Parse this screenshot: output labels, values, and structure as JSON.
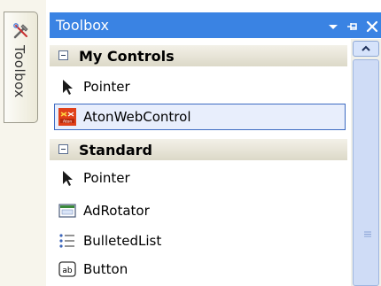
{
  "toolbox_tab": {
    "label": "Toolbox",
    "icon": "tools-icon"
  },
  "titlebar": {
    "title": "Toolbox",
    "buttons": [
      "dropdown-arrow-icon",
      "pin-icon",
      "close-icon"
    ]
  },
  "categories": [
    {
      "label": "My Controls",
      "items": [
        {
          "label": "Pointer",
          "icon": "pointer-icon"
        },
        {
          "label": "AtonWebControl",
          "icon": "aton-control-icon",
          "selected": true
        }
      ]
    },
    {
      "label": "Standard",
      "items": [
        {
          "label": "Pointer",
          "icon": "pointer-icon"
        },
        {
          "label": "AdRotator",
          "icon": "adrotator-icon"
        },
        {
          "label": "BulletedList",
          "icon": "bulleted-list-icon"
        },
        {
          "label": "Button",
          "icon": "button-icon"
        }
      ]
    }
  ],
  "colors": {
    "titlebar": "#3a83e3",
    "selection_border": "#3d6bc2",
    "category_bg": "#e8e6da"
  }
}
